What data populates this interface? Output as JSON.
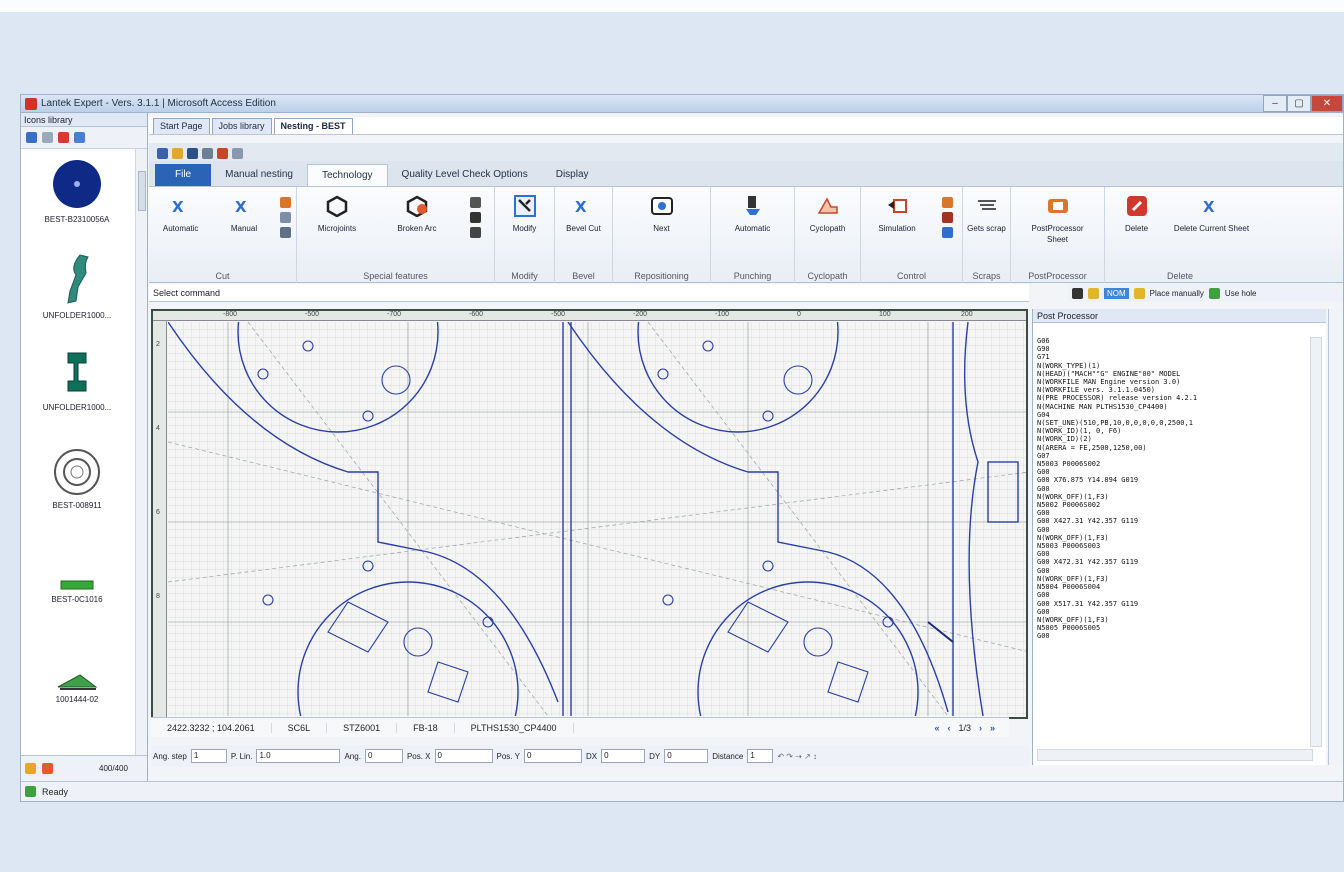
{
  "window": {
    "title": "Lantek Expert - Vers. 3.1.1 | Microsoft Access Edition"
  },
  "library": {
    "header": "Icons library",
    "items": [
      {
        "label": "BEST-B2310056A",
        "icon": "blue-disc"
      },
      {
        "label": "UNFOLDER1000...",
        "icon": "bent-profile"
      },
      {
        "label": "UNFOLDER1000...",
        "icon": "bracket-part"
      },
      {
        "label": "BEST-008911",
        "icon": "ring-part"
      },
      {
        "label": "BEST-0C1016",
        "icon": "strip-part"
      },
      {
        "label": "1001444-02",
        "icon": "wedge-part"
      }
    ],
    "bottom_count": "400/400"
  },
  "doc_tabs": [
    "Start Page",
    "Jobs library",
    "Nesting - BEST"
  ],
  "ribbon_tabs": [
    "File",
    "Manual nesting",
    "Technology",
    "Quality Level Check Options",
    "Display"
  ],
  "active_ribbon_tab": "Technology",
  "ribbon_groups": [
    {
      "caption": "Cut",
      "buttons": [
        "Automatic",
        "Manual"
      ]
    },
    {
      "caption": "Special features",
      "buttons": [
        "Microjoints",
        "Broken Arc"
      ]
    },
    {
      "caption": "Modify",
      "buttons": [
        "Modify"
      ]
    },
    {
      "caption": "Bevel",
      "buttons": [
        "Bevel Cut"
      ]
    },
    {
      "caption": "Repositioning",
      "buttons": [
        "Next"
      ]
    },
    {
      "caption": "Punching",
      "buttons": [
        "Automatic"
      ]
    },
    {
      "caption": "Cyclopath",
      "buttons": [
        "Cyclopath"
      ]
    },
    {
      "caption": "Control",
      "buttons": [
        "Simulation"
      ]
    },
    {
      "caption": "Scraps",
      "buttons": [
        "Gets scrap"
      ]
    },
    {
      "caption": "PostProcessor",
      "buttons": [
        "PostProcessor Sheet"
      ]
    },
    {
      "caption": "Delete",
      "buttons": [
        "Delete",
        "Delete Current Sheet"
      ]
    }
  ],
  "command_line": "Select command",
  "placement": {
    "mode_label": "NOM",
    "place_label": "Place manually",
    "use_label": "Use hole"
  },
  "ruler_top": [
    "-800",
    "-500",
    "-700",
    "-600",
    "-500",
    "-200",
    "-100",
    "0",
    "100",
    "200"
  ],
  "ruler_left": [
    "2",
    "4",
    "6",
    "8"
  ],
  "canvas_status": {
    "coords": "2422.3232 ; 104.2061",
    "material": "SC6L",
    "sheet": "STZ6001",
    "thickness": "FB-18",
    "machine": "PLTHS1530_CP4400",
    "page": "1/3"
  },
  "inputs": {
    "ang_step_label": "Ang. step",
    "ang_step_value": "1",
    "p_lin_label": "P. Lin.",
    "p_lin_value": "1.0",
    "ang_label": "Ang.",
    "ang_value": "0",
    "pos_x_label": "Pos. X",
    "pos_x_value": "0",
    "pos_y_label": "Pos. Y",
    "pos_y_value": "0",
    "dx_label": "DX",
    "dx_value": "0",
    "dy_label": "DY",
    "dy_value": "0",
    "distance_label": "Distance",
    "distance_value": "1"
  },
  "postprocessor": {
    "title": "Post Processor",
    "code": "G06\nG90\nG71\nN(WORK_TYPE)(1)\nN(HEAD)(\"MACH\"\"G\" ENGINE\"00\" MODEL\nN(WORKFILE MAN Engine version 3.0)\nN(WORKFILE vers. 3.1.1.0450)\nN(PRE PROCESSOR) release version 4.2.1\nN(MACHINE MAN PLTHS1530_CP4400)\nG04\nN(SET_UNE)(510,PB,10,0,0,0,0,0,2500,1\nN(WORK_ID)(1, 0, F6)\nN(WORK_ID)(2)\nN(ARERA = FE,2500,1250,00)\nG07\nN5003 P0006S002\nG00\nG00 X76.875 Y14.894 G019\nG00\nN(WORK_OFF)(1,F3)\nN5002 P0006S002\nG00\nG00 X427.31 Y42.357 G119\nG00\nN(WORK_OFF)(1,F3)\nN5003 P0006S003\nG00\nG00 X472.31 Y42.357 G119\nG00\nN(WORK_OFF)(1,F3)\nN5004 P0006S004\nG00\nG00 X517.31 Y42.357 G119\nG00\nN(WORK_OFF)(1,F3)\nN5005 P0006S005\nG00"
  },
  "status": "Ready",
  "colors": {
    "file_tab": "#2b63b6",
    "part_line": "#2a3fa8",
    "canvas_frame": "#3b4d42",
    "grid": "#9aa3a0"
  }
}
